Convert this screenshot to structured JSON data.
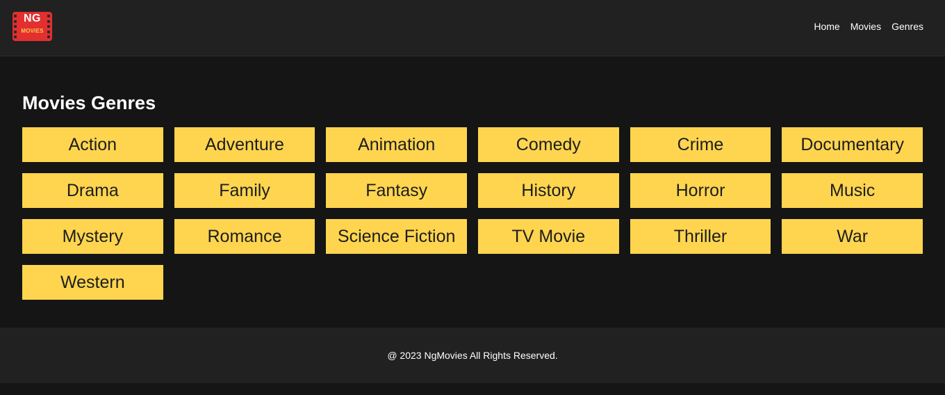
{
  "logo": {
    "top_text": "NG",
    "bottom_text": "MOVIES"
  },
  "nav": {
    "items": [
      "Home",
      "Movies",
      "Genres"
    ]
  },
  "page": {
    "title": "Movies Genres"
  },
  "genres": [
    "Action",
    "Adventure",
    "Animation",
    "Comedy",
    "Crime",
    "Documentary",
    "Drama",
    "Family",
    "Fantasy",
    "History",
    "Horror",
    "Music",
    "Mystery",
    "Romance",
    "Science Fiction",
    "TV Movie",
    "Thriller",
    "War",
    "Western"
  ],
  "footer": {
    "text": "@ 2023 NgMovies All Rights Reserved."
  },
  "colors": {
    "header_bg": "#212121",
    "page_bg": "#151515",
    "genre_bg": "#ffd54f",
    "logo_bg": "#e32f2f"
  }
}
